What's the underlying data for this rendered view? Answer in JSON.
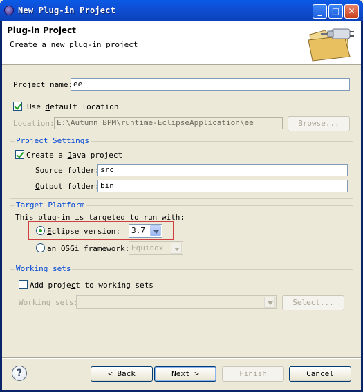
{
  "window": {
    "title": "New Plug-in Project"
  },
  "header": {
    "title": "Plug-in Project",
    "description": "Create a new plug-in project",
    "icon": "wizard-folder-plug-icon"
  },
  "project": {
    "name_label_u": "P",
    "name_label_rest": "roject name:",
    "name_value": "ee",
    "use_default_prefix": "Use ",
    "use_default_u": "d",
    "use_default_rest": "efault location",
    "use_default_checked": true,
    "location_label_u": "L",
    "location_label_rest": "ocation:",
    "location_value": "E:\\Autumn BPM\\runtime-EclipseApplication\\ee",
    "browse_label": "Browse..."
  },
  "settings": {
    "group_title": "Project Settings",
    "java_prefix": "Create a ",
    "java_u": "J",
    "java_rest": "ava project",
    "java_checked": true,
    "source_u": "S",
    "source_rest": "ource folder:",
    "source_value": "src",
    "output_u": "O",
    "output_rest": "utput folder:",
    "output_value": "bin"
  },
  "target": {
    "group_title": "Target Platform",
    "intro": "This plug-in is targeted to run with:",
    "eclipse_u": "E",
    "eclipse_rest": "clipse version:",
    "eclipse_selected": true,
    "eclipse_value": "3.7",
    "osgi_prefix": "an ",
    "osgi_u": "O",
    "osgi_rest": "SGi framework:",
    "osgi_value": "Equinox"
  },
  "working_sets": {
    "group_title": "Working sets",
    "add_prefix": "Add proje",
    "add_u": "c",
    "add_rest": "t to working sets",
    "add_checked": false,
    "sets_u": "W",
    "sets_rest": "orking sets:",
    "select_label": "Select..."
  },
  "footer": {
    "help": "?",
    "back_u": "B",
    "back_rest": "ack",
    "back_prefix": "< ",
    "next_u": "N",
    "next_rest": "ext >",
    "finish_u": "F",
    "finish_rest": "inish",
    "cancel_label": "Cancel"
  },
  "colors": {
    "title_bar": "#0f4fd6",
    "group_title": "#0046d5",
    "check_mark": "#21a121",
    "highlight_box": "#d04040"
  }
}
